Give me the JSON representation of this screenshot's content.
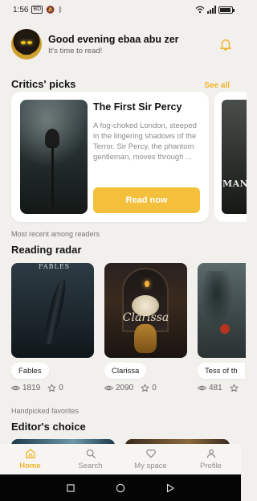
{
  "status_bar": {
    "time": "1:56",
    "badge": "BD",
    "battery_percent": 95
  },
  "header": {
    "greeting": "Good evening ebaa abu zer",
    "subtitle": "It's time to read!",
    "avatar_icon": "avatar",
    "bell_icon": "bell-icon"
  },
  "critics": {
    "title": "Critics' picks",
    "see_all": "See all",
    "featured": {
      "title": "The First Sir Percy",
      "description": "A fog-choked London, steeped in the lingering shadows of the Terror. Sir Percy, the phantom gentleman, moves through ...",
      "button": "Read now"
    },
    "peek_cover_text": "MAN"
  },
  "radar": {
    "label": "Most recent among readers",
    "title": "Reading radar",
    "books": [
      {
        "name": "Fables",
        "views": "1819",
        "stars": "0",
        "cover_top_text": "FABLES"
      },
      {
        "name": "Clarissa",
        "views": "2090",
        "stars": "0",
        "cover_text": "Clarissa"
      },
      {
        "name": "Tess of th",
        "views": "481",
        "stars": ""
      }
    ]
  },
  "editor": {
    "label": "Handpicked favorites",
    "title": "Editor's choice"
  },
  "nav": {
    "items": [
      {
        "label": "Home",
        "icon": "home-icon"
      },
      {
        "label": "Search",
        "icon": "search-icon"
      },
      {
        "label": "My space",
        "icon": "heart-icon"
      },
      {
        "label": "Profile",
        "icon": "profile-icon"
      }
    ],
    "active": "Home",
    "accent": "#f0b52a"
  },
  "colors": {
    "accent": "#f4bf3a",
    "background": "#f2f0ed"
  }
}
